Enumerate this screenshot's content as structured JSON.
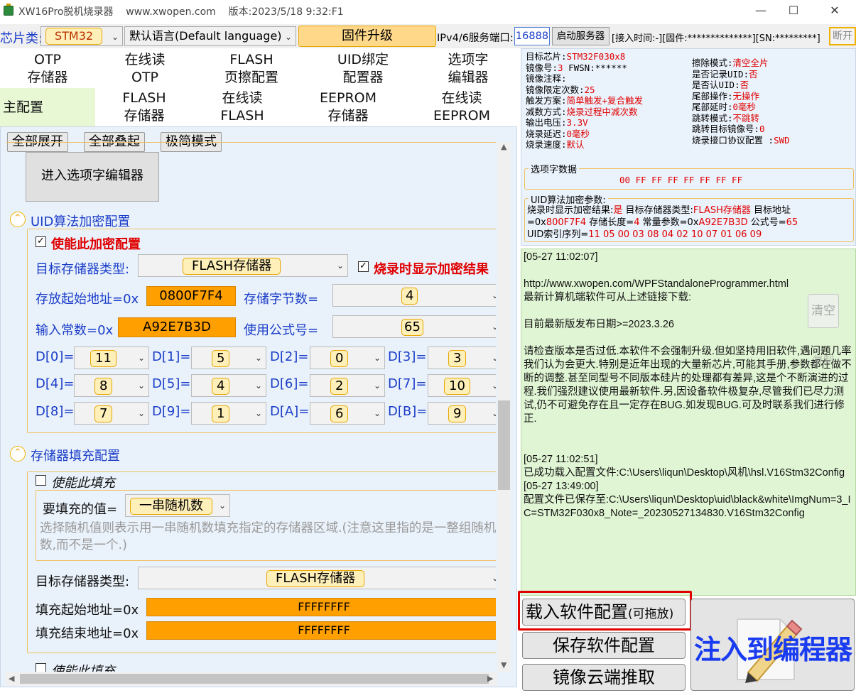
{
  "title": "XW16Pro脱机烧录器    www.xwopen.com    版本:2023/5/18 9:32:F1",
  "toolbar": {
    "chip_label": "芯片类:",
    "chip_value": "STM32",
    "language": "默认语言(Default language)",
    "firmware_upgrade": "固件升级",
    "port_label": "IPv4/6服务端口:",
    "port_value": "16888",
    "start_server": "启动服务器",
    "status": "[接入时间:-][固件:**************][SN:*********]",
    "disconnect": "断开"
  },
  "tabs_row1": [
    "OTP\n存储器",
    "在线读\nOTP",
    "FLASH\n页擦配置",
    "UID绑定\n配置器",
    "选项字\n编辑器"
  ],
  "tabs_row2": [
    "主配置",
    "FLASH\n存储器",
    "在线读\nFLASH",
    "EEPROM\n存储器",
    "在线读\nEEPROM"
  ],
  "left": {
    "expand_all": "全部展开",
    "collapse_all": "全部叠起",
    "minimal_mode": "极简模式",
    "enter_option_editor": "进入选项字编辑器",
    "uid_section": "UID算法加密配置",
    "enable_encrypt": "使能此加密配置",
    "target_mem_type_label": "目标存储器类型:",
    "target_mem_type_value": "FLASH存储器",
    "show_result": "烧录时显示加密结果",
    "start_addr_label": "存放起始地址=0x",
    "start_addr_value": "0800F7F4",
    "byte_count_label": "存储字节数=",
    "byte_count_value": "4",
    "const_label": "输入常数=0x",
    "const_value": "A92E7B3D",
    "formula_label": "使用公式号=",
    "formula_value": "65",
    "d_labels": [
      "D[0]=",
      "D[1]=",
      "D[2]=",
      "D[3]=",
      "D[4]=",
      "D[5]=",
      "D[6]=",
      "D[7]=",
      "D[8]=",
      "D[9]=",
      "D[A]=",
      "D[B]="
    ],
    "d_values": [
      "11",
      "5",
      "0",
      "3",
      "8",
      "4",
      "2",
      "10",
      "7",
      "1",
      "6",
      "9"
    ],
    "fill_section": "存储器填充配置",
    "enable_fill": "使能此填充",
    "fill_value_label": "要填充的值=",
    "fill_value": "一串随机数",
    "fill_note": "选择随机值则表示用一串随机数填充指定的存储器区域.(注意这里指的是一整组随机数,而不是一个.)",
    "fill_target_label": "目标存储器类型:",
    "fill_target_value": "FLASH存储器",
    "fill_start_label": "填充起始地址=0x",
    "fill_start_value": "FFFFFFFF",
    "fill_end_label": "填充结束地址=0x",
    "fill_end_value": "FFFFFFFF",
    "enable_fill2": "使能此填充"
  },
  "info": {
    "left_col": [
      [
        "目标芯片:",
        "STM32F030x8"
      ],
      [
        "镜像号:",
        "3",
        " FWSN:******"
      ],
      [
        "镜像注释:",
        ""
      ],
      [
        "镜像限定次数:",
        "25"
      ],
      [
        "触发方案:",
        "简单触发+复合触发"
      ],
      [
        "减数方式:",
        "烧录过程中减次数"
      ],
      [
        "输出电压:",
        "3.3V"
      ],
      [
        "烧录延迟:",
        "0毫秒"
      ],
      [
        "烧录速度:",
        "默认"
      ]
    ],
    "right_col": [
      [
        "擦除模式:",
        "清空全片"
      ],
      [
        "是否记录UID:",
        "否"
      ],
      [
        "是否认UID:",
        "否"
      ],
      [
        "尾部操作:",
        "无操作"
      ],
      [
        "尾部延时:",
        "0毫秒"
      ],
      [
        "跳转模式:",
        "不跳转"
      ],
      [
        "跳转目标镜像号:",
        "0"
      ],
      [
        "烧录接口协议配置 :",
        "SWD"
      ]
    ],
    "option_bytes_title": "选项字数据",
    "option_bytes": "00 FF FF FF FF FF FF FF",
    "uid_params_title": "UID算法加密参数:",
    "uid_line1_a": "烧录时显示加密结果:",
    "uid_line1_b": "是",
    "uid_line1_c": "  目标存储器类型:",
    "uid_line1_d": "FLASH存储器",
    "uid_line1_e": "  目标地址",
    "uid_line2_a": "=0x",
    "uid_line2_b": "800F7F4",
    "uid_line2_c": "  存储长度=",
    "uid_line2_d": "4",
    "uid_line2_e": "  常量参数=0x",
    "uid_line2_f": "A92E7B3D",
    "uid_line2_g": "  公式号=",
    "uid_line2_h": "65",
    "uid_line3_a": "UID索引序列=",
    "uid_line3_b": "11 05 00 03 08 04 02 10 07 01 06 09"
  },
  "log": {
    "lines": [
      "[05-27 11:02:07]",
      "",
      "http://www.xwopen.com/WPFStandaloneProgrammer.html",
      "最新计算机端软件可从上述链接下载:",
      "",
      "目前最新版发布日期>=2023.3.26",
      "",
      "请检查版本是否过低.本软件不会强制升级.但如坚持用旧软件,遇问题几率我们认为会更大.特别是近年出现的大量新芯片,可能其手册,参数都在做不断的调整.甚至同型号不同版本硅片的处理都有差异,这是个不断演进的过程.我们强烈建议使用最新软件.另,因设备软件极复杂,尽管我们已尽力测试,仍不可避免存在且一定存在BUG.如发现BUG.可及时联系我们进行修正.",
      "",
      "",
      "[05-27 11:02:51]",
      "已成功载入配置文件:C:\\Users\\liqun\\Desktop\\风机\\hsl.V16Stm32Config",
      "[05-27 13:49:00]",
      "配置文件已保存至:C:\\Users\\liqun\\Desktop\\uid\\black&white\\ImgNum=3_IC=STM32F030x8_Note=_20230527134830.V16Stm32Config"
    ],
    "clear": "清空",
    "copy": "复制"
  },
  "actions": {
    "load_config": "载入软件配置",
    "load_config_note": "(可拖放)",
    "save_config": "保存软件配置",
    "cloud_fetch": "镜像云端推取",
    "inject": "注入到编程器"
  }
}
